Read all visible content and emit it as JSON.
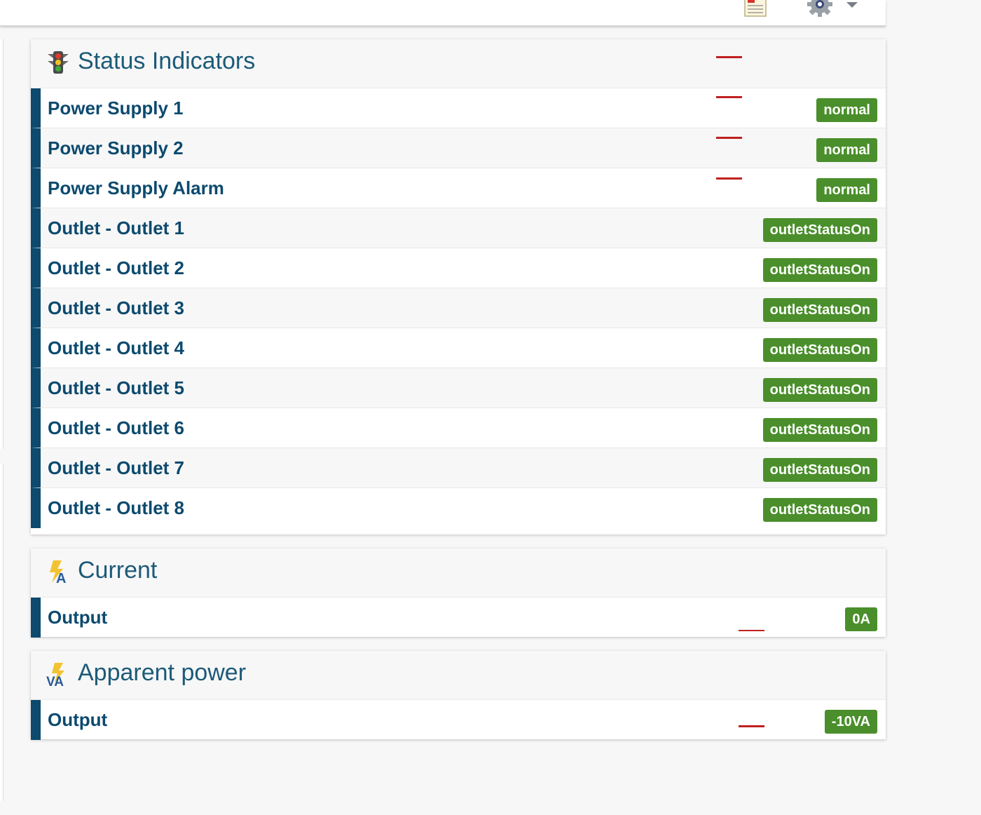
{
  "colors": {
    "accent": "#0d4a6e",
    "title": "#1c5a78",
    "badge_ok": "#4a8f2b",
    "marker": "#c02020"
  },
  "toolbar": {
    "pdf_icon": "pdf-report-icon",
    "settings_icon": "gear-icon",
    "menu_icon": "chevron-down-icon"
  },
  "status_panel": {
    "title": "Status Indicators",
    "icon": "traffic-light-icon",
    "rows": [
      {
        "label": "Power Supply 1",
        "value": "normal"
      },
      {
        "label": "Power Supply 2",
        "value": "normal"
      },
      {
        "label": "Power Supply Alarm",
        "value": "normal"
      },
      {
        "label": "Outlet - Outlet 1",
        "value": "outletStatusOn"
      },
      {
        "label": "Outlet - Outlet 2",
        "value": "outletStatusOn"
      },
      {
        "label": "Outlet - Outlet 3",
        "value": "outletStatusOn"
      },
      {
        "label": "Outlet - Outlet 4",
        "value": "outletStatusOn"
      },
      {
        "label": "Outlet - Outlet 5",
        "value": "outletStatusOn"
      },
      {
        "label": "Outlet - Outlet 6",
        "value": "outletStatusOn"
      },
      {
        "label": "Outlet - Outlet 7",
        "value": "outletStatusOn"
      },
      {
        "label": "Outlet - Outlet 8",
        "value": "outletStatusOn"
      }
    ]
  },
  "current_panel": {
    "title": "Current",
    "icon": "current-ampere-icon",
    "rows": [
      {
        "label": "Output",
        "value": "0A"
      }
    ]
  },
  "power_panel": {
    "title": "Apparent power",
    "icon": "volt-ampere-icon",
    "rows": [
      {
        "label": "Output",
        "value": "-10VA"
      }
    ]
  }
}
